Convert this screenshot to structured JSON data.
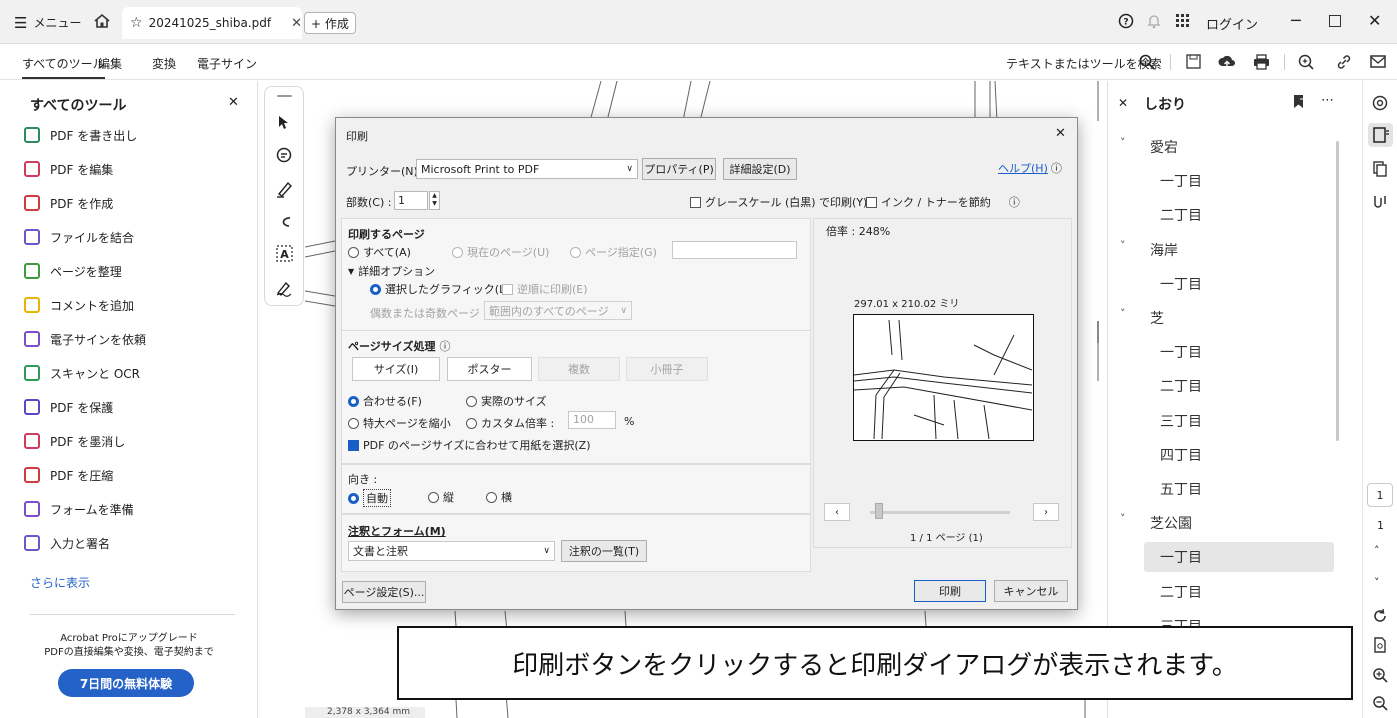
{
  "titlebar": {
    "menu_label": "メニュー",
    "tab_title": "20241025_shiba.pdf",
    "create_label": "+ 作成",
    "login_label": "ログイン"
  },
  "menubar": {
    "items": [
      "すべてのツール",
      "編集",
      "変換",
      "電子サイン"
    ],
    "search_label": "テキストまたはツールを検索"
  },
  "leftpanel": {
    "title": "すべてのツール",
    "items": [
      {
        "label": "PDF を書き出し",
        "color": "#2d8a5f"
      },
      {
        "label": "PDF を編集",
        "color": "#d23b5a"
      },
      {
        "label": "PDF を作成",
        "color": "#d23b3b"
      },
      {
        "label": "ファイルを結合",
        "color": "#6f56c7"
      },
      {
        "label": "ページを整理",
        "color": "#3e9b3e"
      },
      {
        "label": "コメントを追加",
        "color": "#e8b400"
      },
      {
        "label": "電子サインを依頼",
        "color": "#7a4fc7"
      },
      {
        "label": "スキャンと OCR",
        "color": "#2e9a55"
      },
      {
        "label": "PDF を保護",
        "color": "#5a48c2"
      },
      {
        "label": "PDF を墨消し",
        "color": "#d23b5a"
      },
      {
        "label": "PDF を圧縮",
        "color": "#d23b3b"
      },
      {
        "label": "フォームを準備",
        "color": "#7a4fc7"
      },
      {
        "label": "入力と署名",
        "color": "#6f56c7"
      }
    ],
    "more_label": "さらに表示",
    "upgrade_text_1": "Acrobat Proにアップグレード",
    "upgrade_text_2": "PDFの直接編集や変換、電子契約まで",
    "trial_button": "7日間の無料体験"
  },
  "doc": {
    "size_label": "2,378 x 3,364 mm"
  },
  "dialog": {
    "title": "印刷",
    "printer_label": "プリンター(N) :",
    "printer_value": "Microsoft Print to PDF",
    "properties_button": "プロパティ(P)",
    "advanced_button": "詳細設定(D)",
    "help_link": "ヘルプ(H)",
    "copies_label": "部数(C) :",
    "copies_value": "1",
    "grayscale_label": "グレースケール (白黒) で印刷(Y)",
    "save_ink_label": "インク / トナーを節約",
    "pages_section_title": "印刷するページ",
    "radio_all": "すべて(A)",
    "radio_current": "現在のページ(U)",
    "radio_pages": "ページ指定(G)",
    "more_options": "詳細オプション",
    "selected_graphics": "選択したグラフィック(L)",
    "reverse_order": "逆順に印刷(E)",
    "odd_even_label": "偶数または奇数ページ :",
    "odd_even_value": "範囲内のすべてのページ",
    "size_section_title": "ページサイズ処理",
    "btn_size": "サイズ(I)",
    "btn_poster": "ポスター",
    "btn_multiple": "複数",
    "btn_booklet": "小冊子",
    "radio_fit": "合わせる(F)",
    "radio_actual": "実際のサイズ",
    "radio_shrink": "特大ページを縮小",
    "radio_custom": "カスタム倍率 :",
    "custom_value": "100",
    "percent": "%",
    "choose_paper": "PDF のページサイズに合わせて用紙を選択(Z)",
    "orientation_title": "向き :",
    "orient_auto": "自動",
    "orient_portrait": "縦",
    "orient_landscape": "横",
    "comments_title": "注釈とフォーム(M)",
    "comments_value": "文書と注釈",
    "comments_list_button": "注釈の一覧(T)",
    "scale_label": "倍率 : 248%",
    "preview_size": "297.01 x 210.02 ミリ",
    "page_counter": "1 / 1 ページ (1)",
    "page_setup_button": "ページ設定(S)...",
    "print_button": "印刷",
    "cancel_button": "キャンセル"
  },
  "bookmarks": {
    "title": "しおり",
    "entries": [
      {
        "label": "愛宕",
        "level": 0
      },
      {
        "label": "一丁目",
        "level": 1
      },
      {
        "label": "二丁目",
        "level": 1
      },
      {
        "label": "海岸",
        "level": 0
      },
      {
        "label": "一丁目",
        "level": 1
      },
      {
        "label": "芝",
        "level": 0
      },
      {
        "label": "一丁目",
        "level": 1
      },
      {
        "label": "二丁目",
        "level": 1
      },
      {
        "label": "三丁目",
        "level": 1
      },
      {
        "label": "四丁目",
        "level": 1
      },
      {
        "label": "五丁目",
        "level": 1
      },
      {
        "label": "芝公園",
        "level": 0
      },
      {
        "label": "一丁目",
        "level": 1
      },
      {
        "label": "二丁目",
        "level": 1
      },
      {
        "label": "三丁目",
        "level": 1
      }
    ]
  },
  "rail": {
    "page_number": "1",
    "page_total": "1"
  },
  "caption": {
    "text": "印刷ボタンをクリックすると印刷ダイアログが表示されます。"
  }
}
